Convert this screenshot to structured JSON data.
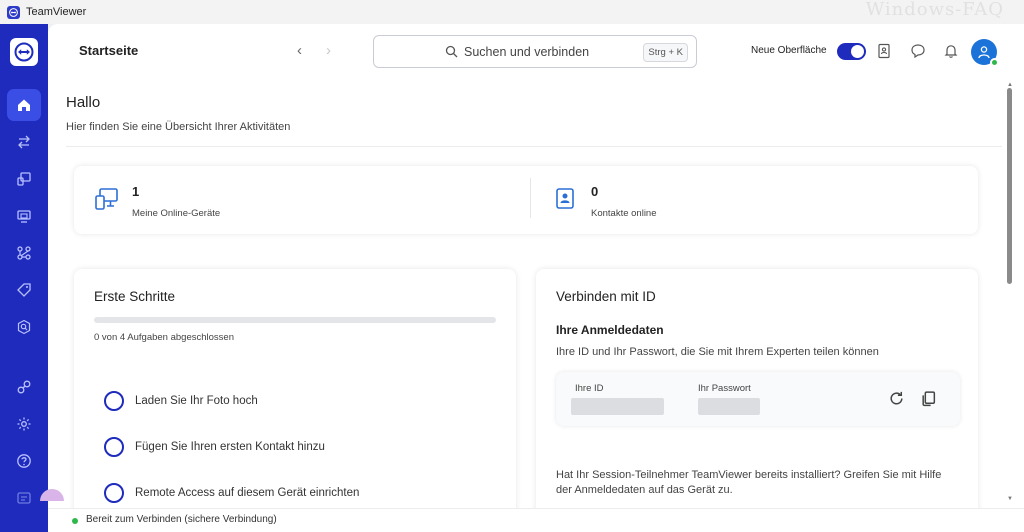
{
  "window": {
    "title": "TeamViewer",
    "watermark": "Windows-FAQ"
  },
  "header": {
    "page_title": "Startseite",
    "search_placeholder": "Suchen und verbinden",
    "search_shortcut": "Strg + K",
    "new_ui_label": "Neue Oberfläche",
    "new_ui_enabled": true
  },
  "rail": {
    "items": [
      "home-icon",
      "transfer-icon",
      "remote-icon",
      "devices-icon",
      "workflow-icon",
      "tag-icon",
      "search-device-icon",
      "integrations-icon",
      "settings-icon",
      "help-icon",
      "feedback-icon"
    ],
    "active": "home-icon"
  },
  "welcome": {
    "title": "Hallo",
    "subtitle": "Hier finden Sie eine Übersicht Ihrer Aktivitäten"
  },
  "stats": [
    {
      "value": "1",
      "label": "Meine Online-Geräte"
    },
    {
      "value": "0",
      "label": "Kontakte online"
    }
  ],
  "first_steps": {
    "title": "Erste Schritte",
    "progress_text": "0 von 4 Aufgaben abgeschlossen",
    "progress_fraction": 0,
    "tasks": [
      "Laden Sie Ihr Foto hoch",
      "Fügen Sie Ihren ersten Kontakt hinzu",
      "Remote Access auf diesem Gerät einrichten"
    ]
  },
  "connect": {
    "title": "Verbinden mit ID",
    "credentials_title": "Ihre Anmeldedaten",
    "credentials_desc": "Ihre ID und Ihr Passwort, die Sie mit Ihrem Experten teilen können",
    "id_label": "Ihre ID",
    "password_label": "Ihr Passwort",
    "note": "Hat Ihr Session-Teilnehmer TeamViewer bereits installiert? Greifen Sie mit Hilfe der Anmeldedaten auf das Gerät zu."
  },
  "status": {
    "text": "Bereit zum Verbinden (sichere Verbindung)",
    "color": "#2fb84a"
  },
  "colors": {
    "accent": "#1e2bbd",
    "avatar": "#1b72d8"
  }
}
